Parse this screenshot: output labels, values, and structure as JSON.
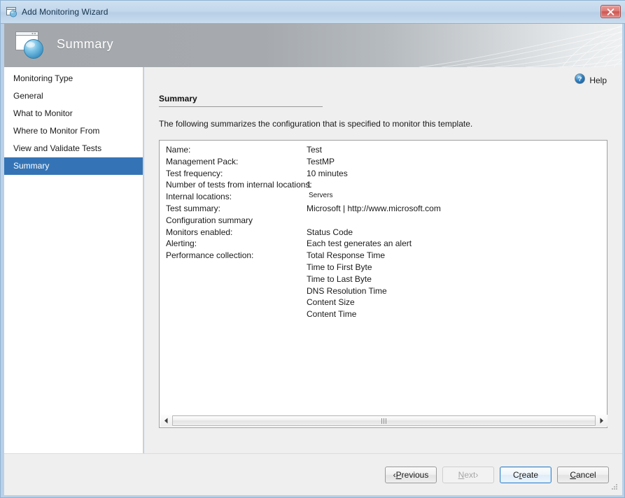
{
  "window": {
    "title": "Add Monitoring Wizard",
    "titlebar_icon": "wizard-window-icon",
    "close_icon": "close-icon",
    "frame_color": "#b9d0e8",
    "titlebar_color": "#c3d8ec"
  },
  "banner": {
    "title": "Summary",
    "icon": "wizard-page-globe-icon"
  },
  "sidebar": {
    "items": [
      {
        "label": "Monitoring Type",
        "selected": false
      },
      {
        "label": "General",
        "selected": false
      },
      {
        "label": "What to Monitor",
        "selected": false
      },
      {
        "label": "Where to Monitor From",
        "selected": false
      },
      {
        "label": "View and Validate Tests",
        "selected": false
      },
      {
        "label": "Summary",
        "selected": true
      }
    ],
    "selected_color": "#3474b6"
  },
  "content": {
    "help": {
      "label": "Help",
      "icon": "help-circle-icon"
    },
    "section_title": "Summary",
    "intro": "The following summarizes the configuration that is specified to monitor this template.",
    "summary_rows": [
      {
        "label": "Name:",
        "value": "Test",
        "small": false
      },
      {
        "label": "Management Pack:",
        "value": "TestMP",
        "small": false
      },
      {
        "label": "Test frequency:",
        "value": "10 minutes",
        "small": false
      },
      {
        "label": "Number of tests from internal locations:",
        "value": "1",
        "small": false
      },
      {
        "label": "Internal locations:",
        "value": "Servers",
        "small": true
      },
      {
        "label": "Test summary:",
        "value": "Microsoft | http://www.microsoft.com",
        "small": false
      },
      {
        "label": "Configuration summary",
        "value": "",
        "small": false
      },
      {
        "label": "Monitors enabled:",
        "value": "Status Code",
        "small": false
      },
      {
        "label": "Alerting:",
        "value": "Each test generates an alert",
        "small": false
      },
      {
        "label": "Performance collection:",
        "value": "Total Response Time",
        "small": false
      },
      {
        "label": "",
        "value": "Time to First Byte",
        "small": false
      },
      {
        "label": "",
        "value": "Time to Last Byte",
        "small": false
      },
      {
        "label": "",
        "value": "DNS Resolution Time",
        "small": false
      },
      {
        "label": "",
        "value": "Content Size",
        "small": false
      },
      {
        "label": "",
        "value": "Content Time",
        "small": false
      }
    ],
    "scrollbar": {
      "left_arrow_icon": "triangle-left-icon",
      "right_arrow_icon": "triangle-right-icon",
      "grip_icon": "grip-dots-icon"
    }
  },
  "footer": {
    "buttons": [
      {
        "name": "previous",
        "prefix": "‹ ",
        "accel": "P",
        "rest": "revious",
        "suffix": "",
        "state": "enabled"
      },
      {
        "name": "next",
        "prefix": "",
        "accel": "N",
        "rest": "ext",
        "suffix": " ›",
        "state": "disabled"
      },
      {
        "name": "create",
        "prefix": "C",
        "accel": "r",
        "rest": "eate",
        "suffix": "",
        "state": "default"
      },
      {
        "name": "cancel",
        "prefix": "",
        "accel": "C",
        "rest": "ancel",
        "suffix": "",
        "state": "enabled"
      }
    ]
  }
}
